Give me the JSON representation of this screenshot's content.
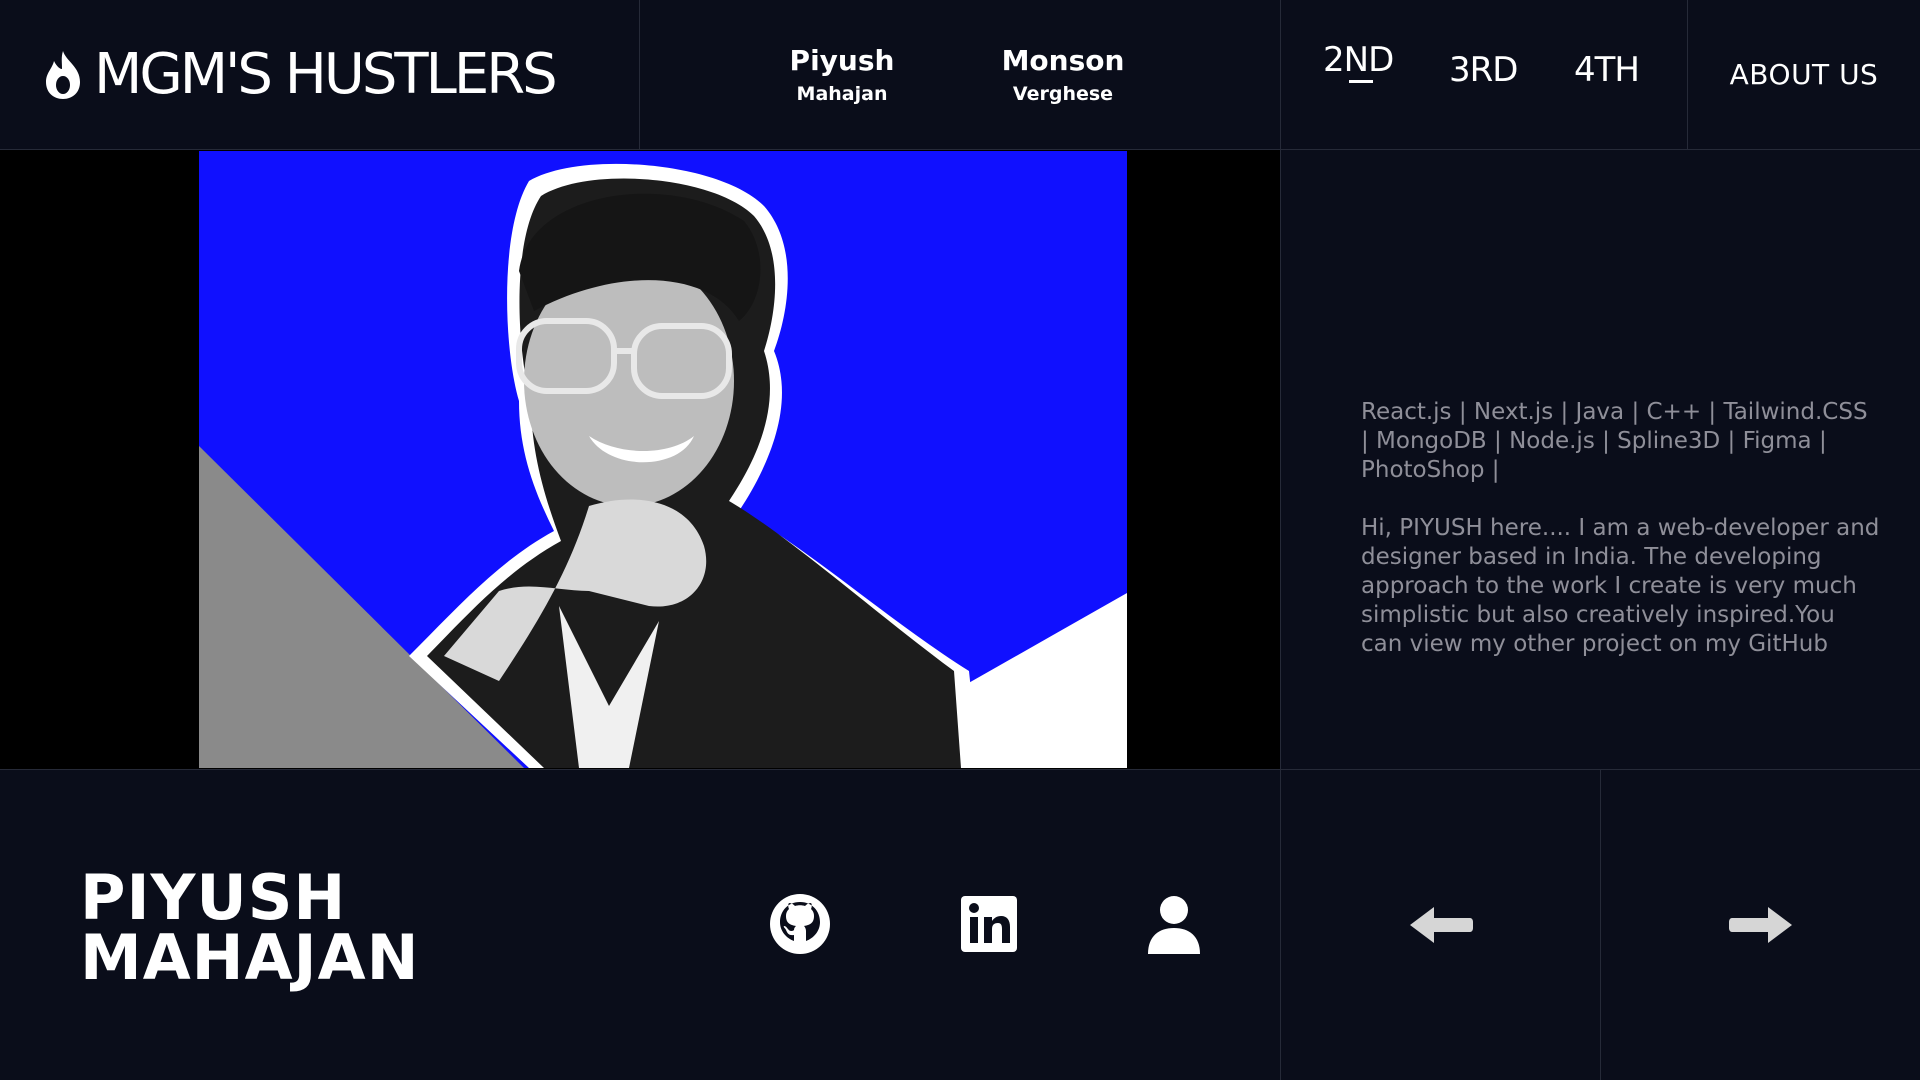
{
  "header": {
    "brand": "MGM'S HUSTLERS",
    "members": [
      {
        "first": "Piyush",
        "last": "Mahajan"
      },
      {
        "first": "Monson",
        "last": "Verghese"
      }
    ],
    "years": [
      "2ND",
      "3RD",
      "4TH"
    ],
    "active_year": "2ND",
    "about_label": "ABOUT US"
  },
  "profile": {
    "name_line1": "PIYUSH",
    "name_line2": "MAHAJAN",
    "skills": "React.js | Next.js | Java | C++ | Tailwind.CSS | MongoDB | Node.js | Spline3D | Figma | PhotoShop |",
    "bio": "Hi, PIYUSH here.... I am a web-developer and designer based in India. The developing approach to the work I create is very much simplistic but also creatively inspired.You can view my other project on my GitHub",
    "social_icons": [
      "github-icon",
      "linkedin-icon",
      "user-icon"
    ]
  },
  "colors": {
    "background": "#0a0d1a",
    "photo_bg": "#1010ff",
    "grey_triangle": "#8a8a8a",
    "muted_text": "#8f8f99",
    "border": "#262a38"
  }
}
